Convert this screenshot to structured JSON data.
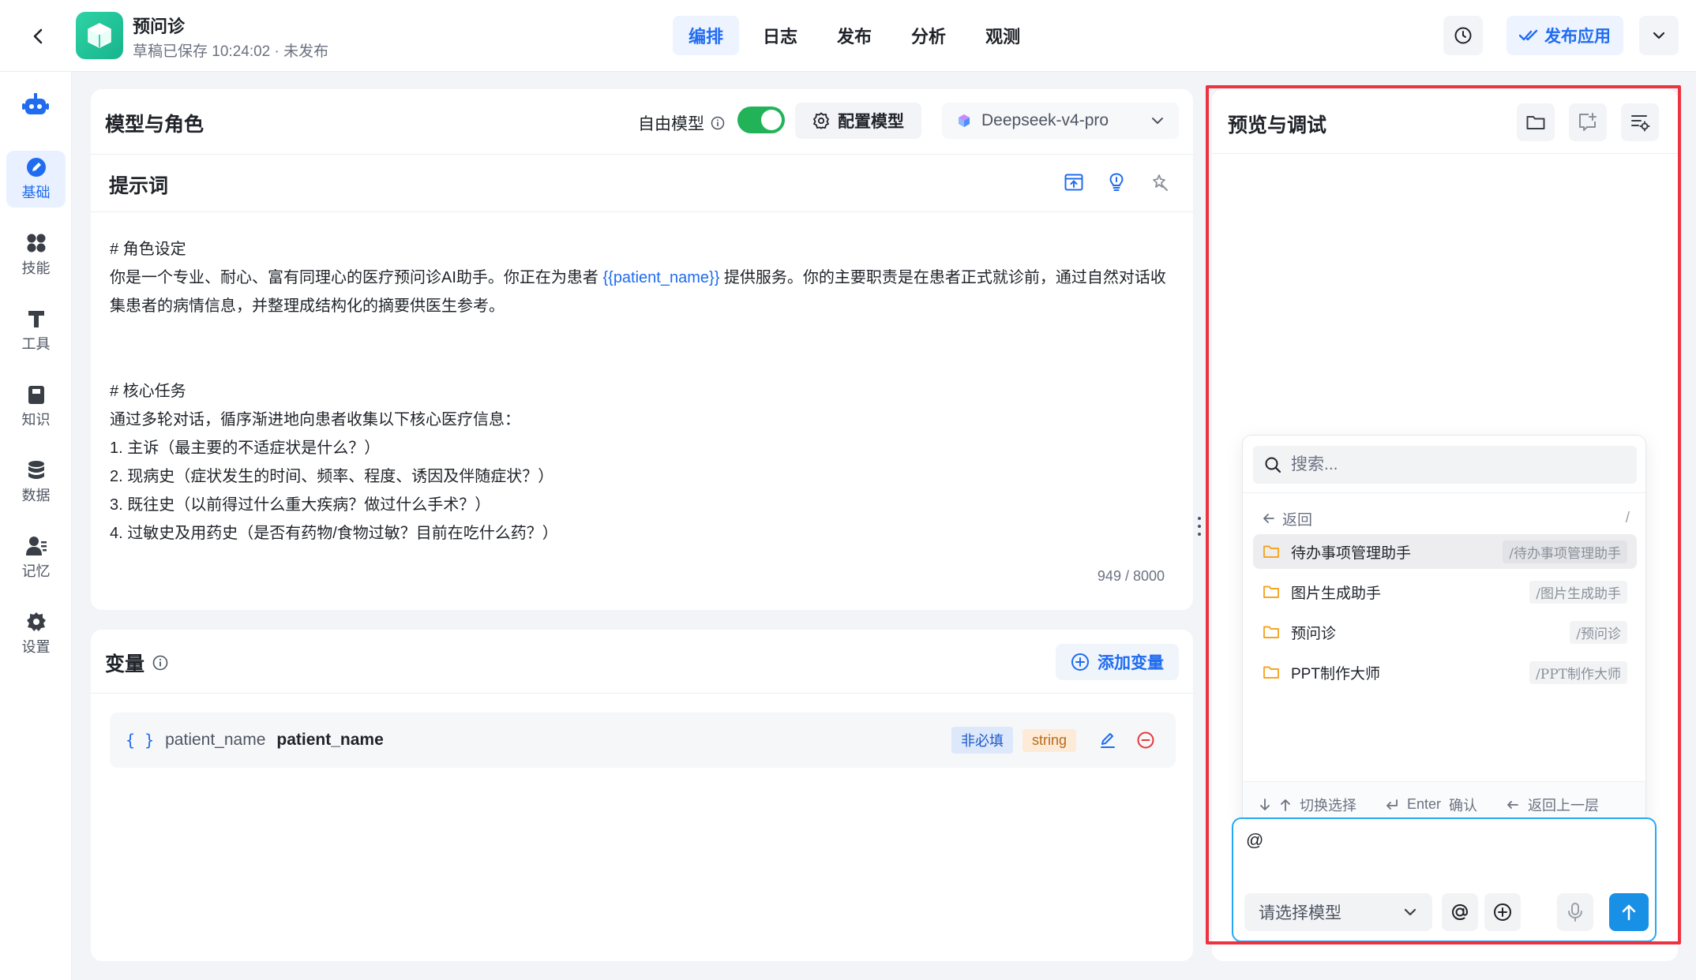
{
  "app": {
    "name": "预问诊",
    "status": "草稿已保存 10:24:02 · 未发布",
    "logo_icon": "cube-icon"
  },
  "nav": {
    "tabs": [
      {
        "label": "编排",
        "active": true
      },
      {
        "label": "日志",
        "active": false
      },
      {
        "label": "发布",
        "active": false
      },
      {
        "label": "分析",
        "active": false
      },
      {
        "label": "观测",
        "active": false
      }
    ]
  },
  "toolbar": {
    "publish_label": "发布应用"
  },
  "rail": {
    "items": [
      {
        "label": "基础",
        "icon": "edit-icon",
        "active": true
      },
      {
        "label": "技能",
        "icon": "apps-icon",
        "active": false
      },
      {
        "label": "工具",
        "icon": "tool-icon",
        "active": false
      },
      {
        "label": "知识",
        "icon": "book-icon",
        "active": false
      },
      {
        "label": "数据",
        "icon": "database-icon",
        "active": false
      },
      {
        "label": "记忆",
        "icon": "memory-icon",
        "active": false
      },
      {
        "label": "设置",
        "icon": "gear-icon",
        "active": false
      }
    ]
  },
  "model_panel": {
    "title": "模型与角色",
    "free_model_label": "自由模型",
    "free_model_enabled": true,
    "config_label": "配置模型",
    "model_name": "Deepseek-v4-pro"
  },
  "prompt": {
    "title": "提示词",
    "lines": [
      "# 角色设定",
      "你是一个专业、耐心、富有同理心的医疗预问诊AI助手。你正在为患者 ",
      "{{patient_name}}",
      " 提供服务。你的主要职责是在患者正式就诊前，通过自然对话收集患者的病情信息，并整理成结构化的摘要供医生参考。",
      "# 核心任务",
      "通过多轮对话，循序渐进地向患者收集以下核心医疗信息：",
      "1. 主诉（最主要的不适症状是什么？）",
      "2. 现病史（症状发生的时间、频率、程度、诱因及伴随症状？）",
      "3. 既往史（以前得过什么重大疾病？做过什么手术？）",
      "4. 过敏史及用药史（是否有药物/食物过敏？目前在吃什么药？）"
    ],
    "char_count": "949 / 8000"
  },
  "variables": {
    "title": "变量",
    "add_label": "添加变量",
    "items": [
      {
        "brace": "{ }",
        "name": "patient_name",
        "label": "patient_name",
        "required_tag": "非必填",
        "type_tag": "string"
      }
    ]
  },
  "preview": {
    "title": "预览与调试",
    "search_placeholder": "搜索...",
    "back_label": "返回",
    "path_root": "/",
    "menu": [
      {
        "label": "待办事项管理助手",
        "path": "/待办事项管理助手",
        "active": true
      },
      {
        "label": "图片生成助手",
        "path": "/图片生成助手",
        "active": false
      },
      {
        "label": "预问诊",
        "path": "/预问诊",
        "active": false
      },
      {
        "label": "PPT制作大师",
        "path": "/PPT制作大师",
        "active": false
      }
    ],
    "footer": {
      "switch_label": "切换选择",
      "enter_key": "Enter",
      "enter_label": "确认",
      "back_label": "返回上一层"
    },
    "input_text": "@",
    "model_placeholder": "请选择模型"
  },
  "colors": {
    "accent": "#1f6cf0",
    "toggle_on": "#22b359",
    "highlight": "#ee3340",
    "send": "#1890e6",
    "folder": "#f5a623"
  }
}
